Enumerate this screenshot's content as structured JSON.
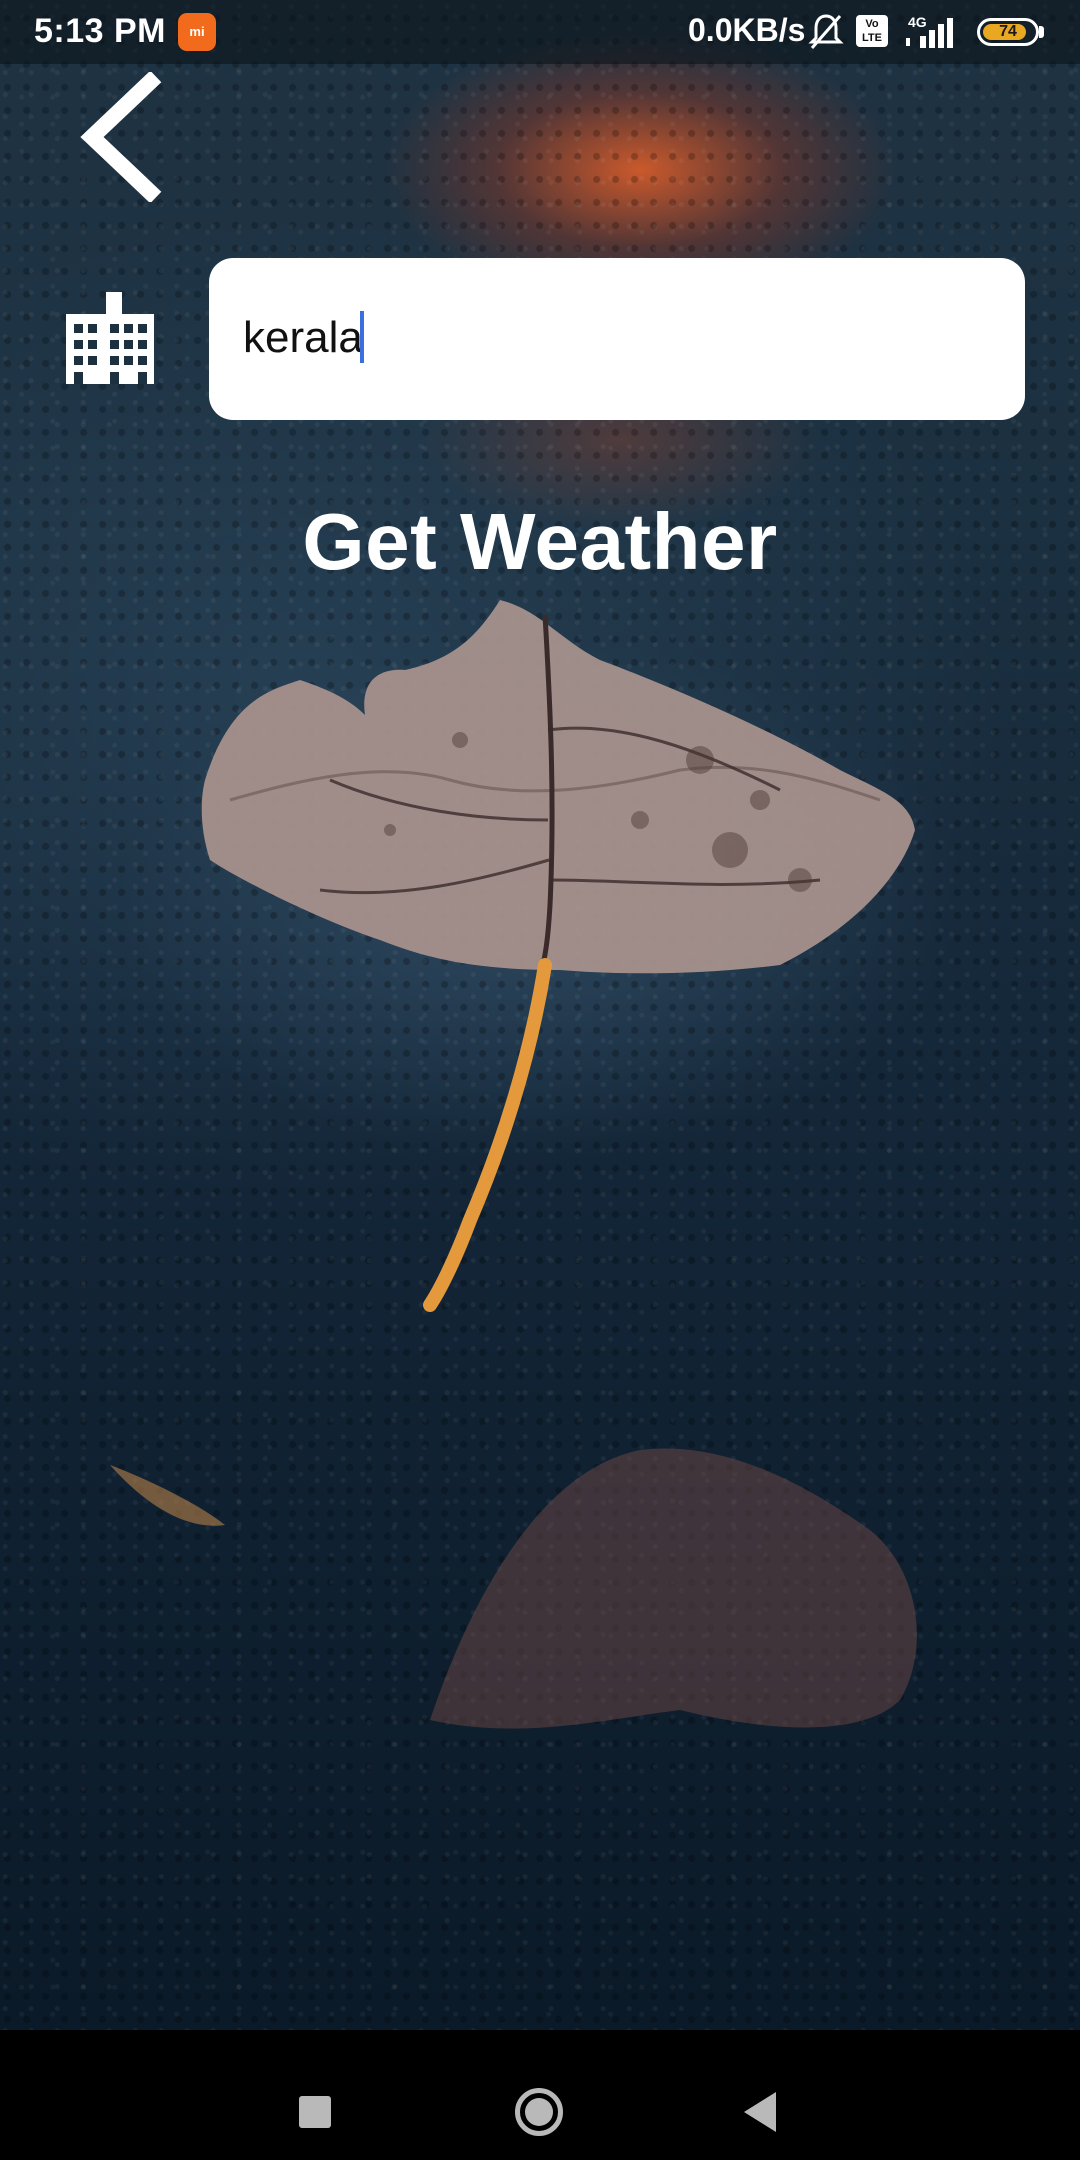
{
  "status_bar": {
    "time": "5:13 PM",
    "network_speed": "0.0KB/s",
    "volte_label": "Vo LTE",
    "network_type": "4G",
    "battery_level": "74"
  },
  "header": {
    "back_icon": "chevron-left-icon"
  },
  "city_search": {
    "icon": "city-buildings-icon",
    "value": "kerala",
    "placeholder": ""
  },
  "action": {
    "get_weather_label": "Get Weather"
  },
  "colors": {
    "accent_cursor": "#3b6fe0",
    "battery_fill": "#e9a722",
    "mi_icon": "#f26a1b",
    "text_primary": "#ffffff",
    "input_background": "#ffffff"
  },
  "navigation_bar": {
    "recents_icon": "square-icon",
    "home_icon": "circle-icon",
    "back_icon": "triangle-back-icon"
  }
}
